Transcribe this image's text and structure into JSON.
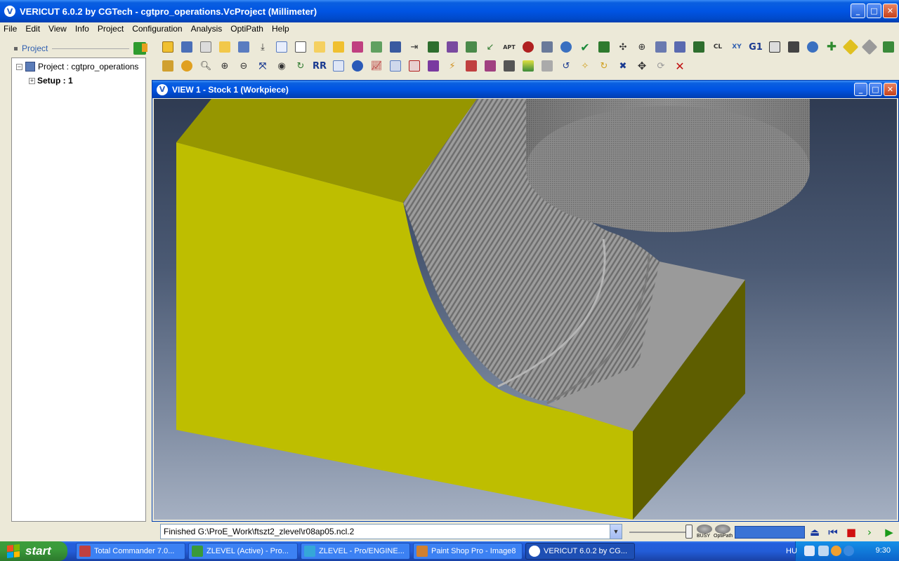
{
  "app": {
    "title": "VERICUT 6.0.2 by CGTech - cgtpro_operations.VcProject (Millimeter)",
    "logo_letter": "V"
  },
  "menu": [
    "File",
    "Edit",
    "View",
    "Info",
    "Project",
    "Configuration",
    "Analysis",
    "OptiPath",
    "Help"
  ],
  "project_panel": {
    "title": "Project",
    "root_label": "Project : cgtpro_operations",
    "setup_label": "Setup : 1"
  },
  "toolbar_icons": {
    "apt_label": "APT",
    "g1_label": "G1",
    "cl_label": "CL",
    "xy_label": "XY",
    "rr_label": "RR",
    "close_x": "✕"
  },
  "view_window": {
    "title": "VIEW 1 - Stock 1 (Workpiece)"
  },
  "status": {
    "message": "Finished G:\\ProE_Work\\ftszt2_zlevel\\r08ap05.ncl.2",
    "busy_label": "BUSY",
    "optipath_label": "OptiPath"
  },
  "taskbar": {
    "start_label": "start",
    "items": [
      {
        "label": "Total Commander 7.0...",
        "color": "#c04040"
      },
      {
        "label": "ZLEVEL (Active) - Pro...",
        "color": "#3a9a3a"
      },
      {
        "label": "ZLEVEL - Pro/ENGINE...",
        "color": "#35a7d8"
      },
      {
        "label": "Paint Shop Pro - Image8",
        "color": "#d08030"
      },
      {
        "label": "VERICUT 6.0.2 by CG...",
        "color": "#ffffff"
      }
    ],
    "language": "HU",
    "clock": "9:30"
  },
  "colors": {
    "stock_yellow": "#bebe00",
    "stock_dark": "#5e5e00",
    "machined_gray": "#9a9a9a",
    "tool_gray": "#7a7a7a"
  }
}
